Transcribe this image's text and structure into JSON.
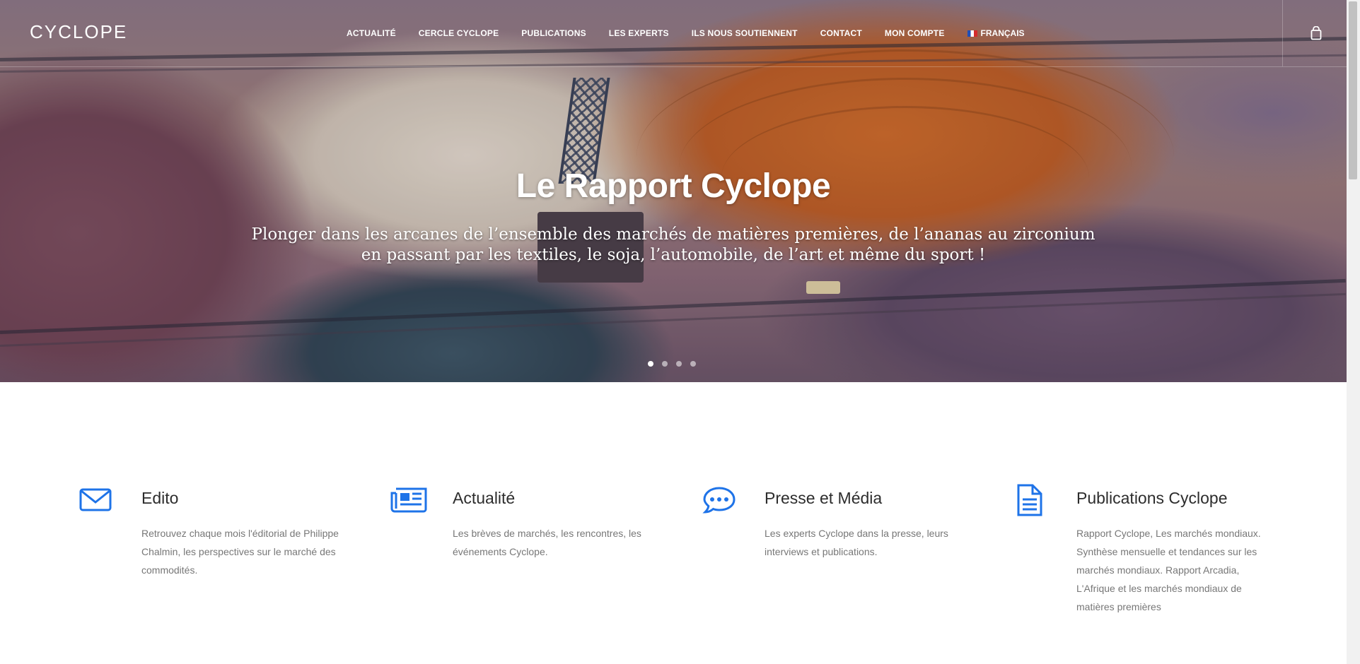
{
  "brand": {
    "logo": "CYCLOPE"
  },
  "nav": {
    "items": [
      "ACTUALITÉ",
      "CERCLE CYCLOPE",
      "PUBLICATIONS",
      "LES EXPERTS",
      "ILS NOUS SOUTIENNENT",
      "CONTACT",
      "MON COMPTE"
    ],
    "language": "FRANÇAIS",
    "language_flag": "french-flag-icon",
    "cart_icon": "shopping-bag-icon"
  },
  "hero": {
    "title": "Le Rapport Cyclope",
    "subtitle": "Plonger dans les arcanes de l’ensemble des marchés de matières premières, de l’ananas au zirconium en passant par les textiles, le soja, l’automobile, de l’art et même du sport !",
    "slides_total": 4,
    "slide_active": 1
  },
  "features": [
    {
      "icon": "envelope-icon",
      "title": "Edito",
      "text": "Retrouvez chaque mois l'éditorial de Philippe Chalmin, les perspectives sur le marché des commodités."
    },
    {
      "icon": "newspaper-icon",
      "title": "Actualité",
      "text": "Les brèves de marchés, les rencontres, les événements Cyclope."
    },
    {
      "icon": "speech-bubble-icon",
      "title": "Presse et Média",
      "text": "Les experts Cyclope dans la presse, leurs interviews et publications."
    },
    {
      "icon": "document-icon",
      "title": "Publications Cyclope",
      "text": "Rapport Cyclope, Les marchés mondiaux. Synthèse mensuelle et tendances sur les marchés mondiaux. Rapport Arcadia, L'Afrique et les marchés mondiaux de matières premières"
    }
  ],
  "colors": {
    "accent": "#1e73e8",
    "heading": "#2d2d2d",
    "body_text": "#777777"
  }
}
